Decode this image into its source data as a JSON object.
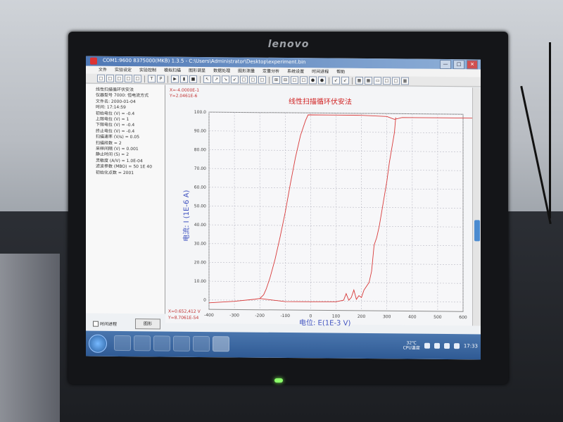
{
  "monitor": {
    "brand": "lenovo"
  },
  "window": {
    "title": "COM1:9600 8375000(MKB) 1.3.5 - C:\\Users\\Administrator\\Desktop\\experiment.bin",
    "buttons": [
      "—",
      "□",
      "✕"
    ]
  },
  "menu": {
    "items": [
      "文件",
      "实验设定",
      "实验控制",
      "模拟扫描",
      "图形调显",
      "数据处理",
      "图形测量",
      "定量分析",
      "系统设置",
      "时间进程",
      "帮助"
    ]
  },
  "toolbar": {
    "glyphs": [
      "□",
      "□",
      "□",
      "□",
      "□",
      "|",
      "T",
      "P",
      "|",
      "▶",
      "▮",
      "■",
      "|",
      "↖",
      "↗",
      "↘",
      "↙",
      "□",
      "□",
      "□",
      "|",
      "⊞",
      "⊟",
      "□",
      "□",
      "●",
      "●",
      "|",
      "↙",
      "↙",
      "|",
      "▦",
      "▦",
      "▭",
      "□",
      "□",
      "▦"
    ]
  },
  "left_panel": {
    "params": [
      "线性扫描循环伏安法",
      "仪器型号 7000: 恒电流方式",
      "文件名: 2000-01-04",
      "时间: 17:14:59",
      "初始电位 (V) = -0.4",
      "上限电位 (V) = 1",
      "下限电位 (V) = -0.4",
      "终止电位 (V) = -0.4",
      "扫描速率 (V/s) = 0.05",
      "扫描段数 = 2",
      "采样间隔 (V) = 0.001",
      "静止时间 (S) = 2",
      "灵敏度 (A/V) = 1.0E-04",
      "滤波参数 (MBO) = 50 1E 40",
      "初始化点数 = 2001"
    ],
    "checkbox_label": "时间进程",
    "button_label": "图形"
  },
  "plot": {
    "readout_top": [
      "X=-4.0000E-1",
      "Y=2.0461E-6"
    ],
    "readout_bottom": [
      "X=0.652,412 V",
      "Y=8.7061E-54"
    ],
    "title": "线性扫描循环伏安法",
    "ylabel": "电流:  I (1E-6 A)",
    "xlabel": "电位:  E(1E-3 V)"
  },
  "chart_data": {
    "type": "line",
    "title": "线性扫描循环伏安法",
    "xlabel": "电位: E(1E-3 V)",
    "ylabel": "电流: I (1E-6 A)",
    "xlim": [
      -400,
      600
    ],
    "ylim": [
      -5,
      100
    ],
    "x_ticks": [
      "-400",
      "-300",
      "-200",
      "-100",
      "0",
      "100",
      "200",
      "300",
      "400",
      "500",
      "600"
    ],
    "y_ticks": [
      "0",
      "10.00",
      "20.00",
      "30.00",
      "40.00",
      "50.00",
      "60.00",
      "70.00",
      "80.00",
      "90.00",
      "100.0"
    ],
    "grid": true,
    "series": [
      {
        "color": "#d83a3a",
        "x": [
          -400,
          -300,
          -220,
          -200,
          -185,
          -175,
          -160,
          -140,
          -120,
          -100,
          -80,
          -60,
          -40,
          -20,
          -10,
          100,
          200,
          300,
          330,
          360,
          400,
          500,
          650
        ],
        "y": [
          -1.5,
          -0.6,
          0.6,
          1.0,
          3,
          6,
          12,
          22,
          34,
          47,
          62,
          76,
          88,
          96,
          99,
          99,
          99,
          98.5,
          97,
          98,
          98,
          98,
          98
        ]
      },
      {
        "color": "#d83a3a",
        "x": [
          -200,
          -150,
          -100,
          0,
          100,
          130,
          140,
          150,
          160,
          170,
          180,
          190,
          200,
          210,
          230,
          240,
          250,
          260,
          270,
          280,
          290,
          300,
          310,
          320,
          330,
          335
        ],
        "y": [
          1.0,
          0.2,
          -0.5,
          -0.5,
          -0.4,
          0.5,
          4,
          0.5,
          2,
          6,
          1,
          3,
          2,
          6,
          10,
          16,
          30,
          34,
          40,
          48,
          56,
          64,
          74,
          82,
          90,
          98
        ]
      }
    ]
  },
  "taskbar": {
    "tray_label": "32℃\nCPU温度",
    "clock": "17:33"
  },
  "colors": {
    "curve": "#d83a3a",
    "axis_label": "#4053c0",
    "title": "#d02020",
    "taskbar": "#3a68a4"
  }
}
